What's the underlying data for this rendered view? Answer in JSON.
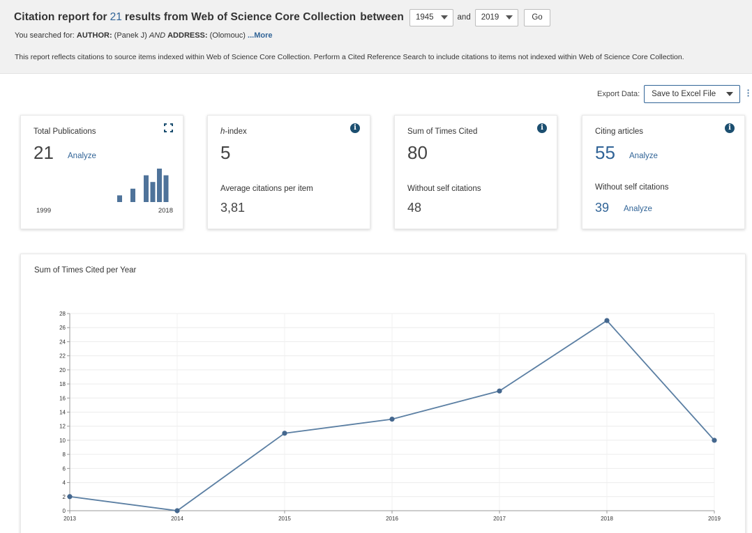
{
  "header": {
    "title_prefix": "Citation report for",
    "result_count": "21",
    "title_suffix": "results from Web of Science Core Collection",
    "between_label": "between",
    "year_from": "1945",
    "and_label": "and",
    "year_to": "2019",
    "go_label": "Go",
    "searched_prefix": "You searched for:",
    "searched_author_key": "AUTHOR:",
    "searched_author_val": "(Panek J)",
    "searched_and": "AND",
    "searched_address_key": "ADDRESS:",
    "searched_address_val": "(Olomouc)",
    "more_label": "...More",
    "note": "This report reflects citations to source items indexed within Web of Science Core Collection. Perform a Cited Reference Search to include citations to items not indexed within Web of Science Core Collection."
  },
  "export": {
    "label": "Export Data:",
    "selected": "Save to Excel File"
  },
  "cards": {
    "total_publications": {
      "label": "Total Publications",
      "value": "21",
      "analyze": "Analyze",
      "year_start": "1999",
      "year_end": "2018",
      "spark_values": [
        1,
        0,
        2,
        0,
        4,
        3,
        5,
        4
      ],
      "icon": "expand-icon"
    },
    "h_index": {
      "label_italic": "h",
      "label_rest": "-index",
      "value": "5",
      "sub_label": "Average citations per item",
      "sub_value": "3,81"
    },
    "times_cited": {
      "label": "Sum of Times Cited",
      "value": "80",
      "sub_label": "Without self citations",
      "sub_value": "48"
    },
    "citing_articles": {
      "label": "Citing articles",
      "value": "55",
      "analyze": "Analyze",
      "sub_label": "Without self citations",
      "sub_value": "39",
      "sub_analyze": "Analyze"
    },
    "info_glyph": "i"
  },
  "colors": {
    "accent": "#316497",
    "info_icon": "#1c4f70",
    "line": "#5b7fa3",
    "bar": "#4f739a"
  },
  "chart_data": {
    "type": "line",
    "title": "Sum of Times Cited per Year",
    "x": [
      "2013",
      "2014",
      "2015",
      "2016",
      "2017",
      "2018",
      "2019"
    ],
    "series": [
      {
        "values": [
          2,
          0,
          11,
          13,
          17,
          27,
          10
        ]
      }
    ],
    "ylim": [
      0,
      28
    ],
    "yticks": [
      0,
      2,
      4,
      6,
      8,
      10,
      12,
      14,
      16,
      18,
      20,
      22,
      24,
      26,
      28
    ],
    "grid": true,
    "xlabel": "",
    "ylabel": ""
  }
}
